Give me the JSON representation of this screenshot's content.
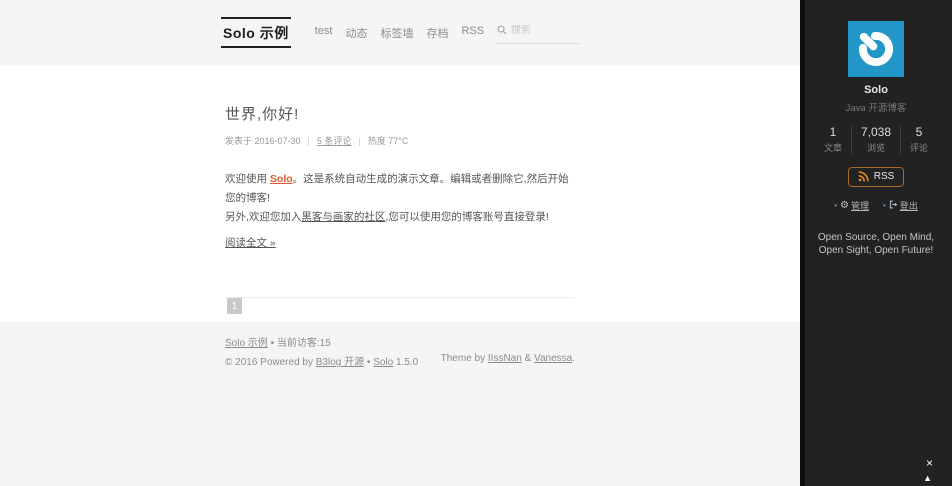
{
  "colors": {
    "accent": "#e2582f",
    "sidebar_bg": "#222222",
    "logo_blue": "#2396c8",
    "rss_orange": "#e08524",
    "bullet_blue": "#4a9fd6",
    "panel_bg": "#f5f5f5"
  },
  "header": {
    "brand": "Solo 示例",
    "nav": [
      "test",
      "动态",
      "标签墙",
      "存档",
      "RSS"
    ],
    "search_placeholder": "搜索"
  },
  "article": {
    "title": "世界,你好!",
    "meta": {
      "published": "发表于 2016-07-30",
      "sep": "|",
      "comments": "5 条评论",
      "heat": "热度 77°C"
    },
    "p1_pre": "欢迎使用 ",
    "p1_link": "Solo",
    "p1_post": "。这是系统自动生成的演示文章。编辑或者删除它,然后开始您的博客!",
    "p2_pre": "另外,欢迎您加入",
    "p2_link": "黑客与画家的社区",
    "p2_post": ",您可以使用您的博客账号直接登录!",
    "read_more": "阅读全文 »"
  },
  "pagination": {
    "current": "1"
  },
  "footer": {
    "site_link": "Solo 示例",
    "visitors": " • 当前访客:15",
    "copyright_pre": "© 2016 Powered by ",
    "b3log_link": "B3log 开源",
    "dot": " • ",
    "solo_link": "Solo",
    "version": " 1.5.0",
    "theme_pre": "Theme by ",
    "author1": "IIssNan",
    "amp": " & ",
    "author2": "Vanessa",
    "period": "."
  },
  "sidebar": {
    "name": "Solo",
    "subtitle": "Java 开源博客",
    "stats": [
      {
        "value": "1",
        "label": "文章"
      },
      {
        "value": "7,038",
        "label": "浏览"
      },
      {
        "value": "5",
        "label": "评论"
      }
    ],
    "rss_label": "RSS",
    "bullet": "•",
    "gear": "⚙",
    "admin_label": "管理",
    "logout_label": "登出",
    "motto_line1": "Open Source, Open Mind,",
    "motto_line2": "Open Sight, Open Future!"
  },
  "overlay": {
    "close": "×",
    "up": "▲"
  }
}
